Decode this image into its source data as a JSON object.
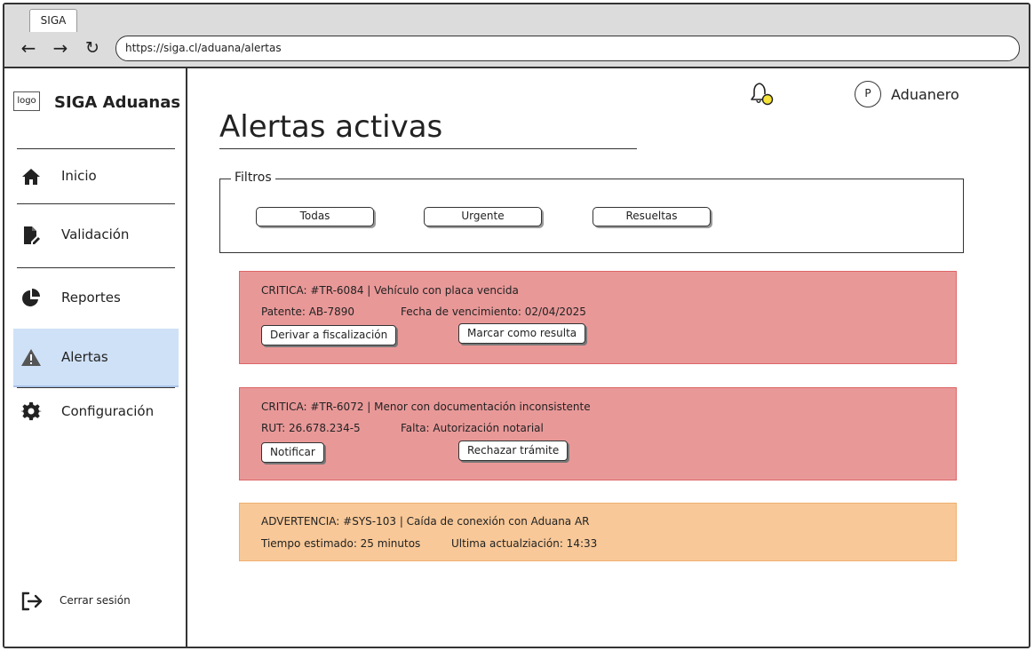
{
  "browser": {
    "tab_title": "SIGA",
    "url": "https://siga.cl/aduana/alertas"
  },
  "sidebar": {
    "logo_text": "logo",
    "brand": "SIGA Aduanas",
    "items": [
      {
        "label": "Inicio",
        "icon": "home-icon"
      },
      {
        "label": "Validación",
        "icon": "document-edit-icon"
      },
      {
        "label": "Reportes",
        "icon": "pie-chart-icon"
      },
      {
        "label": "Alertas",
        "icon": "warning-icon",
        "active": true
      },
      {
        "label": "Configuración",
        "icon": "gear-icon"
      }
    ],
    "logout_label": "Cerrar sesión"
  },
  "header": {
    "avatar_initial": "P",
    "user_name": "Aduanero"
  },
  "main": {
    "title": "Alertas activas",
    "filters": {
      "legend": "Filtros",
      "buttons": [
        "Todas",
        "Urgente",
        "Resueltas"
      ]
    },
    "alerts": [
      {
        "severity": "critical",
        "title": "CRITICA:  #TR-6084 | Vehículo con placa vencida",
        "detail_left": "Patente: AB-7890",
        "detail_right": "Fecha de vencimiento: 02/04/2025",
        "actions": [
          "Derivar a fiscalización",
          "Marcar como resulta"
        ]
      },
      {
        "severity": "critical",
        "title": "CRITICA:  #TR-6072 | Menor con documentación inconsistente",
        "detail_left": "RUT: 26.678.234-5",
        "detail_right": "Falta: Autorización notarial",
        "actions": [
          "Notificar",
          "Rechazar trámite"
        ]
      },
      {
        "severity": "warning",
        "title": "ADVERTENCIA:  #SYS-103 | Caída de conexión con Aduana AR",
        "detail_left": "Tiempo estimado: 25 minutos",
        "detail_right": "Ultima actualziación:  14:33",
        "actions": []
      }
    ]
  },
  "colors": {
    "critical": "#e99898",
    "warning": "#f8c898",
    "active_nav": "#cfe1f7"
  }
}
